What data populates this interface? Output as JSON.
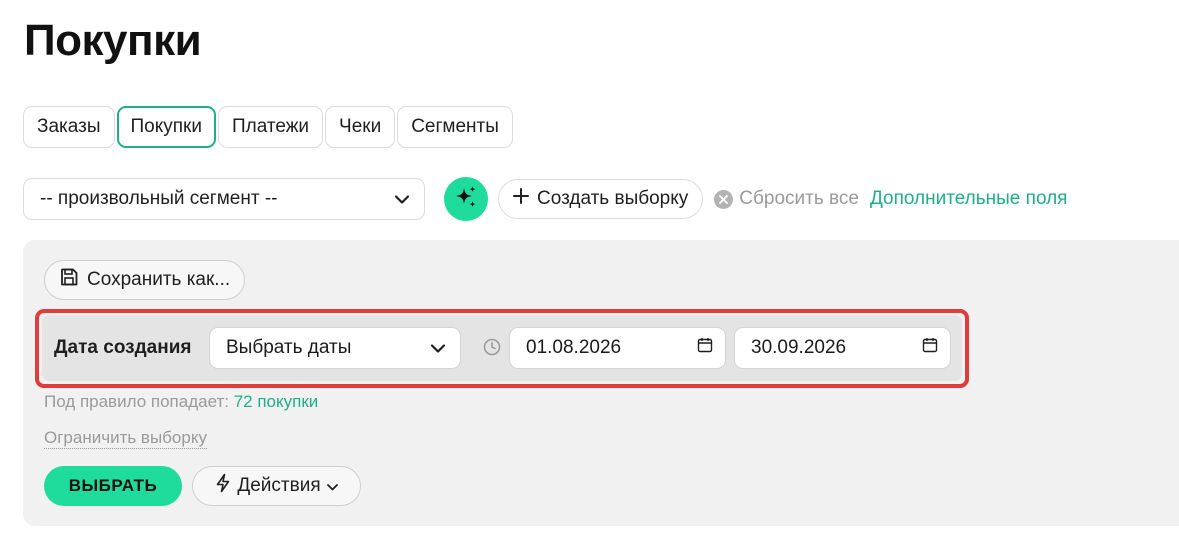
{
  "page": {
    "title": "Покупки"
  },
  "tabs": [
    {
      "label": "Заказы",
      "active": false
    },
    {
      "label": "Покупки",
      "active": true
    },
    {
      "label": "Платежи",
      "active": false
    },
    {
      "label": "Чеки",
      "active": false
    },
    {
      "label": "Сегменты",
      "active": false
    }
  ],
  "toolbar": {
    "segment_value": "-- произвольный сегмент --",
    "ai_icon": "sparkle-icon",
    "create_label": "Создать выборку",
    "reset_label": "Сбросить все",
    "extra_fields_label": "Дополнительные поля"
  },
  "panel": {
    "save_as_label": "Сохранить как...",
    "filter": {
      "label": "Дата создания",
      "mode_value": "Выбрать даты",
      "date_from": "01.08.2026",
      "date_to": "30.09.2026"
    },
    "rule_count_prefix": "Под правило попадает:",
    "rule_count_value": "72 покупки",
    "limit_label": "Ограничить выборку",
    "select_label": "ВЫБРАТЬ",
    "actions_label": "Действия"
  },
  "colors": {
    "accent": "#1fdc9c",
    "accent_text": "#1fae87",
    "highlight": "#e03c3c",
    "panel_bg": "#f1f1f1"
  }
}
